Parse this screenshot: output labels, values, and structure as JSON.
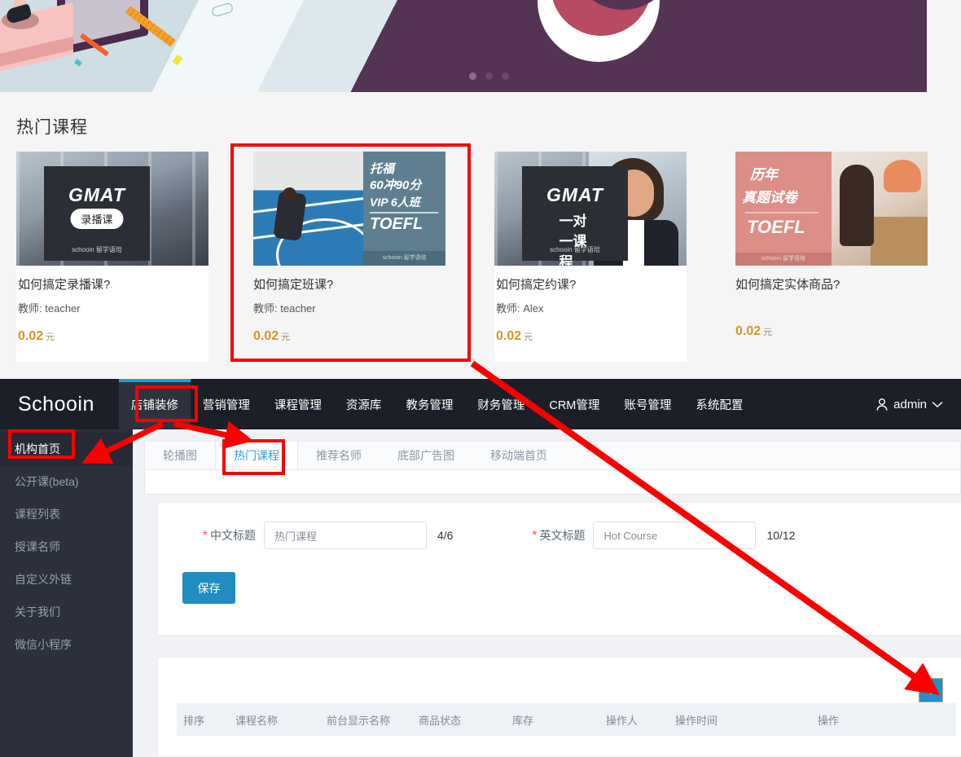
{
  "frontend": {
    "section_title": "热门课程",
    "carousel": {
      "dots": 3,
      "active_index": 0
    },
    "courses": [
      {
        "title": "如何搞定录播课?",
        "teacher_label": "教师:",
        "teacher": "teacher",
        "price": "0.02",
        "unit": "元",
        "thumb": {
          "style": "gmat-recorded",
          "overlay_title": "GMAT",
          "pill": "录播课",
          "brand": "schooin 留学语培"
        }
      },
      {
        "title": "如何搞定班课?",
        "teacher_label": "教师:",
        "teacher": "teacher",
        "price": "0.02",
        "unit": "元",
        "thumb": {
          "style": "toefl-vip",
          "l1": "托福",
          "l2": "60冲90分",
          "l3": "VIP  6人班",
          "l4": "TOEFL",
          "brand": "schooin 留学语培"
        }
      },
      {
        "title": "如何搞定约课?",
        "teacher_label": "教师:",
        "teacher": "Alex",
        "price": "0.02",
        "unit": "元",
        "thumb": {
          "style": "gmat-one-on-one",
          "overlay_title": "GMAT",
          "pill": "一对一课程",
          "brand": "schooin 留学语培"
        }
      },
      {
        "title": "如何搞定实体商品?",
        "teacher_label": "",
        "teacher": "",
        "price": "0.02",
        "unit": "元",
        "thumb": {
          "style": "toefl-past-papers",
          "l1": "历年",
          "l2": "真题试卷",
          "l3": "TOEFL",
          "brand": "schooin 留学语培"
        }
      }
    ]
  },
  "admin": {
    "brand": "Schooin",
    "nav": [
      {
        "label": "店铺装修",
        "active": true
      },
      {
        "label": "营销管理",
        "active": false
      },
      {
        "label": "课程管理",
        "active": false
      },
      {
        "label": "资源库",
        "active": false
      },
      {
        "label": "教务管理",
        "active": false
      },
      {
        "label": "财务管理",
        "active": false
      },
      {
        "label": "CRM管理",
        "active": false
      },
      {
        "label": "账号管理",
        "active": false
      },
      {
        "label": "系统配置",
        "active": false
      }
    ],
    "user": {
      "name": "admin",
      "icon": "user-icon",
      "caret": "chevron-down-icon"
    },
    "sidebar": [
      {
        "label": "机构首页",
        "active": true
      },
      {
        "label": "公开课(beta)",
        "active": false
      },
      {
        "label": "课程列表",
        "active": false
      },
      {
        "label": "授课名师",
        "active": false
      },
      {
        "label": "自定义外链",
        "active": false
      },
      {
        "label": "关于我们",
        "active": false
      },
      {
        "label": "微信小程序",
        "active": false
      }
    ],
    "tabs": [
      {
        "label": "轮播图",
        "active": false
      },
      {
        "label": "热门课程",
        "active": true
      },
      {
        "label": "推荐名师",
        "active": false
      },
      {
        "label": "底部广告图",
        "active": false
      },
      {
        "label": "移动端首页",
        "active": false
      }
    ],
    "form": {
      "cn_label": "中文标题",
      "cn_value": "热门课程",
      "cn_counter": "4/6",
      "en_label": "英文标题",
      "en_value": "Hot Course",
      "en_counter": "10/12",
      "save_label": "保存",
      "required_mark": "*"
    },
    "table": {
      "add_label": "+",
      "headers": [
        "排序",
        "课程名称",
        "前台显示名称",
        "商品状态",
        "库存",
        "操作人",
        "操作时间",
        "操作"
      ]
    }
  },
  "colors": {
    "accent_blue": "#1f9cd6",
    "price_orange": "#d79325",
    "annotation_red": "#fb0000",
    "nav_dark": "#1c1f27",
    "sidebar_dark": "#2b303b",
    "banner_purple": "#553354"
  }
}
